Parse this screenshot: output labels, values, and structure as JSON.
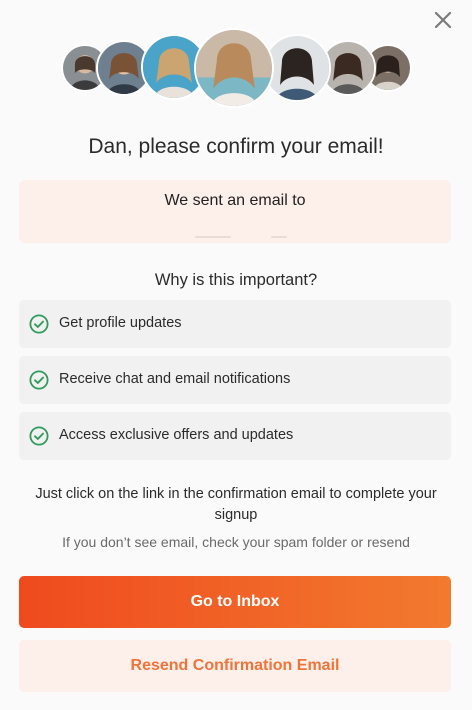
{
  "modal": {
    "title": "Dan, please confirm your email!",
    "close_icon": "close-icon"
  },
  "avatars": {
    "count": 7,
    "icon": "profile-photo"
  },
  "email_notice": {
    "label": "We sent an email to",
    "value": ""
  },
  "why": {
    "heading": "Why is this important?",
    "items": [
      {
        "label": "Get profile updates",
        "icon": "check-circle-icon"
      },
      {
        "label": "Receive chat and email notifications",
        "icon": "check-circle-icon"
      },
      {
        "label": "Access exclusive offers and updates",
        "icon": "check-circle-icon"
      }
    ]
  },
  "instructions": {
    "text": "Just click on the link in the confirmation email to complete your signup",
    "spam_note": "If you don’t see email, check your spam folder or resend"
  },
  "actions": {
    "primary_label": "Go to Inbox",
    "secondary_label": "Resend Confirmation Email"
  },
  "colors": {
    "accent_start": "#ef4a1e",
    "accent_end": "#f27a2e",
    "accent_text": "#f0743a",
    "soft_accent_bg": "#fdefea",
    "check_green": "#2e9c5a"
  }
}
